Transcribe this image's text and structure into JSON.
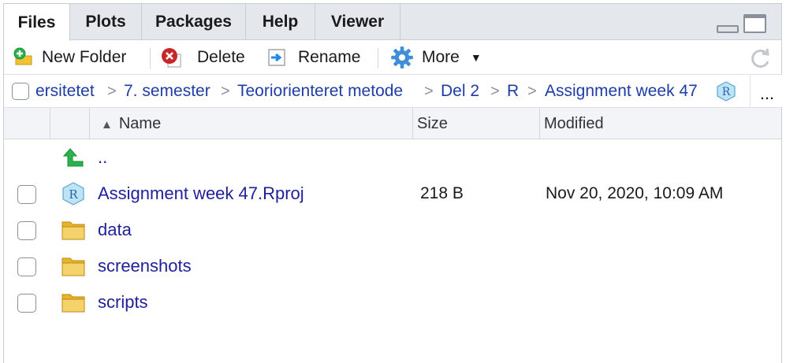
{
  "tabs": [
    {
      "label": "Files",
      "active": true
    },
    {
      "label": "Plots"
    },
    {
      "label": "Packages"
    },
    {
      "label": "Help"
    },
    {
      "label": "Viewer"
    }
  ],
  "toolbar": {
    "new_folder": "New Folder",
    "delete": "Delete",
    "rename": "Rename",
    "more": "More",
    "icons": [
      "new-folder-icon",
      "delete-icon",
      "rename-icon",
      "gear-icon",
      "chevron-down-icon",
      "refresh-icon"
    ]
  },
  "breadcrumb": {
    "items": [
      "ersitetet",
      "7. semester",
      "Teoriorienteret metode",
      "Del 2",
      "R",
      "Assignment week 47"
    ],
    "separator": ">",
    "more": "..."
  },
  "columns": {
    "name": "Name",
    "size": "Size",
    "modified": "Modified",
    "sort_indicator": "▲"
  },
  "files": [
    {
      "name": "..",
      "size": "",
      "modified": "",
      "type": "parent"
    },
    {
      "name": "Assignment week 47.Rproj",
      "size": "218 B",
      "modified": "Nov 20, 2020, 10:09 AM",
      "type": "rproj"
    },
    {
      "name": "data",
      "size": "",
      "modified": "",
      "type": "folder"
    },
    {
      "name": "screenshots",
      "size": "",
      "modified": "",
      "type": "folder"
    },
    {
      "name": "scripts",
      "size": "",
      "modified": "",
      "type": "folder"
    }
  ],
  "colors": {
    "link": "#1f1f9a",
    "breadcrumb": "#1f3ca6",
    "tab_bg": "#e4e7ec",
    "folder": "#f1c232",
    "accent_green": "#2bb24c",
    "delete_red": "#c62828",
    "gear_blue": "#3f8ed8"
  }
}
